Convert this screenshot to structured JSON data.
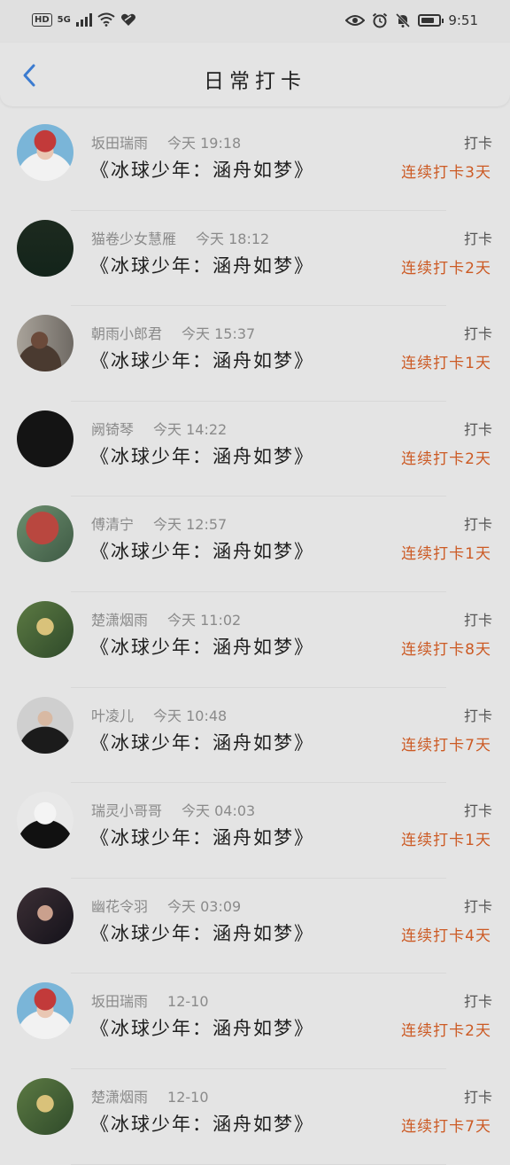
{
  "status": {
    "left_icons": [
      "hd-icon",
      "5g-signal-icon",
      "wifi-icon",
      "heart-link-icon"
    ],
    "hd": "HD",
    "network": "5G",
    "right_icons": [
      "eye-icon",
      "alarm-icon",
      "mute-bell-icon",
      "battery-icon"
    ],
    "time": "9:51"
  },
  "header": {
    "title": "日常打卡"
  },
  "feed": {
    "items": [
      {
        "user": "坂田瑞雨",
        "time": "今天 19:18",
        "book": "《冰球少年：涵舟如梦》",
        "action": "打卡",
        "streak": "连续打卡3天",
        "avatar": "avatar-boy-red-hair"
      },
      {
        "user": "猫卷少女慧雁",
        "time": "今天 18:12",
        "book": "《冰球少年：涵舟如梦》",
        "action": "打卡",
        "streak": "连续打卡2天",
        "avatar": "avatar-dark-text"
      },
      {
        "user": "朝雨小郎君",
        "time": "今天 15:37",
        "book": "《冰球少年：涵舟如梦》",
        "action": "打卡",
        "streak": "连续打卡1天",
        "avatar": "avatar-girl-wall"
      },
      {
        "user": "阙锜琴",
        "time": "今天 14:22",
        "book": "《冰球少年：涵舟如梦》",
        "action": "打卡",
        "streak": "连续打卡2天",
        "avatar": "avatar-black"
      },
      {
        "user": "傅清宁",
        "time": "今天 12:57",
        "book": "《冰球少年：涵舟如梦》",
        "action": "打卡",
        "streak": "连续打卡1天",
        "avatar": "avatar-anime-red"
      },
      {
        "user": "楚潇烟雨",
        "time": "今天 11:02",
        "book": "《冰球少年：涵舟如梦》",
        "action": "打卡",
        "streak": "连续打卡8天",
        "avatar": "avatar-anime-green"
      },
      {
        "user": "叶凌儿",
        "time": "今天 10:48",
        "book": "《冰球少年：涵舟如梦》",
        "action": "打卡",
        "streak": "连续打卡7天",
        "avatar": "avatar-man-suit"
      },
      {
        "user": "瑞灵小哥哥",
        "time": "今天 04:03",
        "book": "《冰球少年：涵舟如梦》",
        "action": "打卡",
        "streak": "连续打卡1天",
        "avatar": "avatar-anime-bw"
      },
      {
        "user": "幽花令羽",
        "time": "今天 03:09",
        "book": "《冰球少年：涵舟如梦》",
        "action": "打卡",
        "streak": "连续打卡4天",
        "avatar": "avatar-boy-dark"
      },
      {
        "user": "坂田瑞雨",
        "time": "12-10",
        "book": "《冰球少年：涵舟如梦》",
        "action": "打卡",
        "streak": "连续打卡2天",
        "avatar": "avatar-boy-red-hair"
      },
      {
        "user": "楚潇烟雨",
        "time": "12-10",
        "book": "《冰球少年：涵舟如梦》",
        "action": "打卡",
        "streak": "连续打卡7天",
        "avatar": "avatar-anime-green"
      }
    ]
  },
  "colors": {
    "accent": "#cc5a24",
    "back_arrow": "#3b7bd0"
  }
}
